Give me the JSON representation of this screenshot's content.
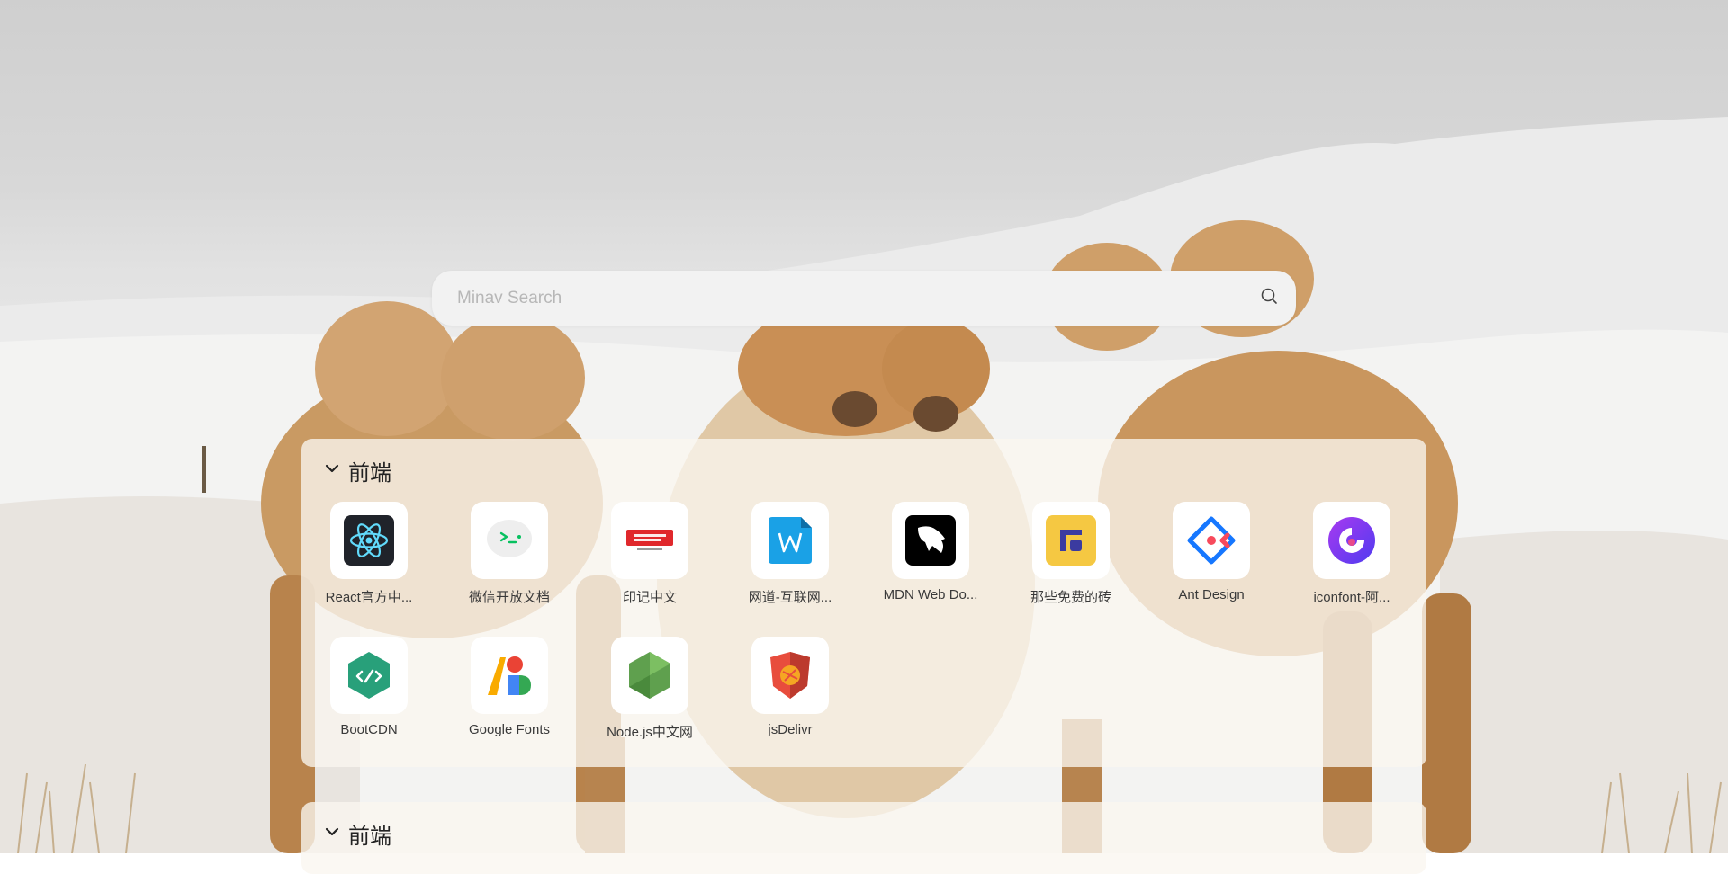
{
  "search": {
    "placeholder": "Minav Search"
  },
  "groups": [
    {
      "title": "前端",
      "sites": [
        {
          "label": "React官方中...",
          "icon": "react-icon"
        },
        {
          "label": "微信开放文档",
          "icon": "wechat-dev-icon"
        },
        {
          "label": "印记中文",
          "icon": "docschina-icon"
        },
        {
          "label": "网道-互联网...",
          "icon": "wangdoc-icon"
        },
        {
          "label": "MDN Web Do...",
          "icon": "mdn-icon"
        },
        {
          "label": "那些免费的砖",
          "icon": "free-bricks-icon"
        },
        {
          "label": "Ant Design",
          "icon": "ant-design-icon"
        },
        {
          "label": "iconfont-阿...",
          "icon": "iconfont-icon"
        },
        {
          "label": "BootCDN",
          "icon": "bootcdn-icon"
        },
        {
          "label": "Google Fonts",
          "icon": "google-fonts-icon"
        },
        {
          "label": "Node.js中文网",
          "icon": "nodejs-icon"
        },
        {
          "label": "jsDelivr",
          "icon": "jsdelivr-icon"
        }
      ]
    },
    {
      "title": "前端",
      "sites": []
    }
  ],
  "colors": {
    "panel_bg": "#faf6f0",
    "search_bg": "#f2f2f2",
    "react": "#61dafb",
    "wechat": "#07c160",
    "docschina": "#e0282c",
    "wangdoc": "#1aa1e6",
    "free_bricks": "#f5c842",
    "ant_design": "#1677ff",
    "iconfont": "#7a3cf0",
    "bootcdn": "#28a07a",
    "nodejs": "#5fa04e",
    "jsdelivr": "#e84d3d"
  }
}
